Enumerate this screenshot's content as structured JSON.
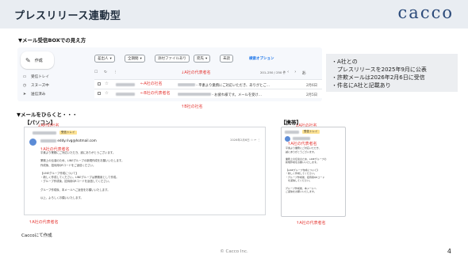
{
  "header": {
    "title": "プレスリリース連動型",
    "logo": "cacco"
  },
  "section1": {
    "heading": "▼メール受信BOXでの見え方"
  },
  "gmail": {
    "compose_label": "作成",
    "nav": [
      {
        "label": "受信トレイ",
        "icon": "inbox-icon"
      },
      {
        "label": "スヌーズ中",
        "icon": "clock-icon"
      },
      {
        "label": "送信済み",
        "icon": "send-icon"
      }
    ],
    "filters": [
      "差出人",
      "全期間",
      "添付ファイルあり",
      "宛先",
      "未読"
    ],
    "advanced_search": "検索オプション",
    "page_info": "201–250 / 250 件",
    "lang": "あ",
    "rows": [
      {
        "subject": "平素より業務にご対応いただき、ありがとご…",
        "date": "2月6日"
      },
      {
        "subject": "お疲れ様です。メールを受け…",
        "date": "2月5日"
      }
    ]
  },
  "annotations": {
    "rep_name_top": "↓A社の代表者名",
    "company_left": "←A社の社名",
    "company_right": "←B社の代表者名",
    "company_bottom": "↑B社の社名"
  },
  "info_box": {
    "lines": [
      "・A社との",
      "　プレスリリースを2025年9月に公表",
      "・許欺メールは2026年2月6日に受信",
      "・件名にA社と記載あり"
    ]
  },
  "section2": {
    "heading": "▼メールをひらくと・・・",
    "pc_label": "【パソコン】",
    "mobile_label": "【携帯】"
  },
  "pc_mail": {
    "anno_company": "↓A社の社名",
    "anno_rep": "↑A社の代表者名",
    "anno_rep_bottom": "↑A社の代表者名",
    "tag": "受信トレイ",
    "from": "xxxxx",
    "from_addr": "eddy.rivg@hotmail.com",
    "meta": "2026年2月6日 ☆ ↩ ⋮",
    "body": [
      "平素より業務にご対応いただき、誠にありがとうございます。",
      "",
      "業務上の伝達のため、LINEグループの新規作成をお願いいたします。",
      "作成後、招待用QRコードをご返信ください。",
      "",
      "【LINEグループ作成について】",
      "・新しく作成してください。LINEグループは業務用として作成。",
      "・グループ作成後、招待用QRコードを返信してください。",
      "",
      "グループ作成後、本メールへご返信をお願いいたします。",
      "",
      "以上、よろしくお願いいたします。"
    ]
  },
  "mobile_mail": {
    "anno_company": "↓A社の社名",
    "anno_rep": "↑A社の代表者名",
    "anno_rep_bottom": "↑A社の代表者名",
    "tag": "受信トレイ",
    "body": [
      "平素より業務にご対応いただき、",
      "誠にありがとうございます。",
      "",
      "業務上の伝達のため、LINEグループの",
      "新規作成をお願いいたします。",
      "",
      "【LINEグループ作成について】",
      "・新しく作成してください。",
      "・グループ作成後、招待用QRコード",
      "　を返信してください。",
      "",
      "グループ作成後、本メールへ",
      "ご返信をお願いいたします。"
    ]
  },
  "footer": {
    "note": "Caccoにて作成",
    "copyright": "© Cacco Inc.",
    "page": "4"
  }
}
